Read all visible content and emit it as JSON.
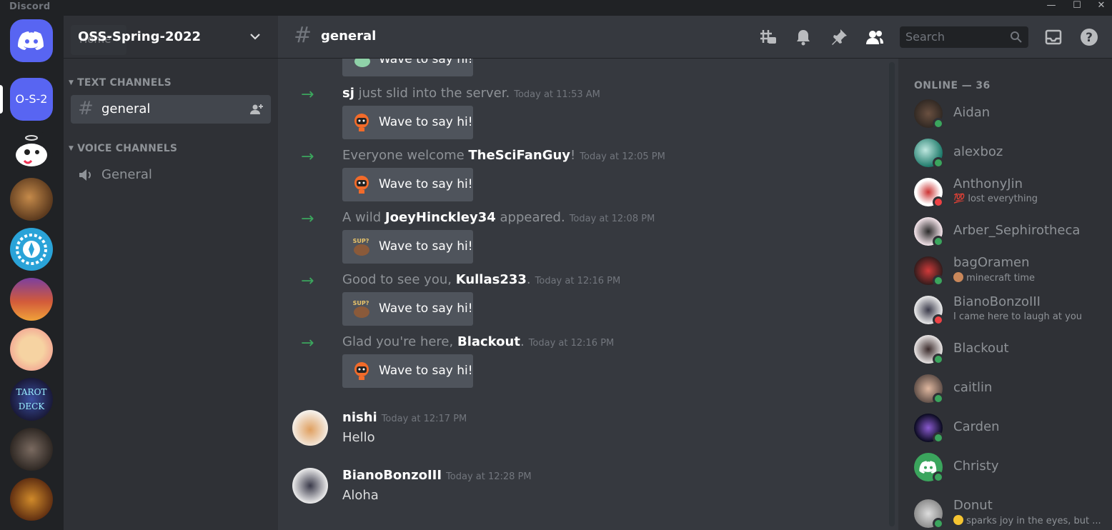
{
  "window": {
    "app_name": "Discord",
    "minimize": "—",
    "maximize": "☐",
    "close": "✕"
  },
  "guilds": {
    "selected": "O-S-2"
  },
  "server": {
    "name": "OSS-Spring-2022",
    "home_tooltip": "Home"
  },
  "categories": {
    "text": "TEXT CHANNELS",
    "voice": "VOICE CHANNELS"
  },
  "channels": {
    "text": [
      "general"
    ],
    "voice": [
      "General"
    ]
  },
  "header": {
    "channel": "general",
    "search_placeholder": "Search"
  },
  "messages": {
    "partial_wave": "Wave to say hi!",
    "system": [
      {
        "pre": "",
        "user": "sj",
        "post": " just slid into the server.",
        "time": "Today at 11:53 AM",
        "wave": "Wave to say hi!"
      },
      {
        "pre": "Everyone welcome ",
        "user": "TheSciFanGuy",
        "post": "!",
        "time": "Today at 12:05 PM",
        "wave": "Wave to say hi!"
      },
      {
        "pre": "A wild ",
        "user": "JoeyHinckley34",
        "post": " appeared.",
        "time": "Today at 12:08 PM",
        "wave": "Wave to say hi!"
      },
      {
        "pre": "Good to see you, ",
        "user": "Kullas233",
        "post": ".",
        "time": "Today at 12:16 PM",
        "wave": "Wave to say hi!"
      },
      {
        "pre": "Glad you're here, ",
        "user": "Blackout",
        "post": ".",
        "time": "Today at 12:16 PM",
        "wave": "Wave to say hi!"
      }
    ],
    "chat": [
      {
        "author": "nishi",
        "time": "Today at 12:17 PM",
        "text": "Hello"
      },
      {
        "author": "BianoBonzoIII",
        "time": "Today at 12:28 PM",
        "text": "Aloha"
      }
    ]
  },
  "members": {
    "header": "ONLINE — 36",
    "list": [
      {
        "name": "Aidan",
        "status_text": "",
        "presence": "online"
      },
      {
        "name": "alexboz",
        "status_text": "",
        "presence": "online"
      },
      {
        "name": "AnthonyJin",
        "status_text": "lost everything",
        "presence": "dnd"
      },
      {
        "name": "Arber_Sephirotheca",
        "status_text": "",
        "presence": "online"
      },
      {
        "name": "bagOramen",
        "status_text": "minecraft time",
        "presence": "online"
      },
      {
        "name": "BianoBonzoIII",
        "status_text": "I came here to laugh at you",
        "presence": "dnd"
      },
      {
        "name": "Blackout",
        "status_text": "",
        "presence": "online"
      },
      {
        "name": "caitlin",
        "status_text": "",
        "presence": "online"
      },
      {
        "name": "Carden",
        "status_text": "",
        "presence": "online"
      },
      {
        "name": "Christy",
        "status_text": "",
        "presence": "online"
      },
      {
        "name": "Donut",
        "status_text": "sparks joy in the eyes, but ...",
        "presence": "online"
      }
    ]
  },
  "colors": {
    "online": "#3ba55d",
    "dnd": "#ed4245",
    "blurple": "#5865f2"
  }
}
